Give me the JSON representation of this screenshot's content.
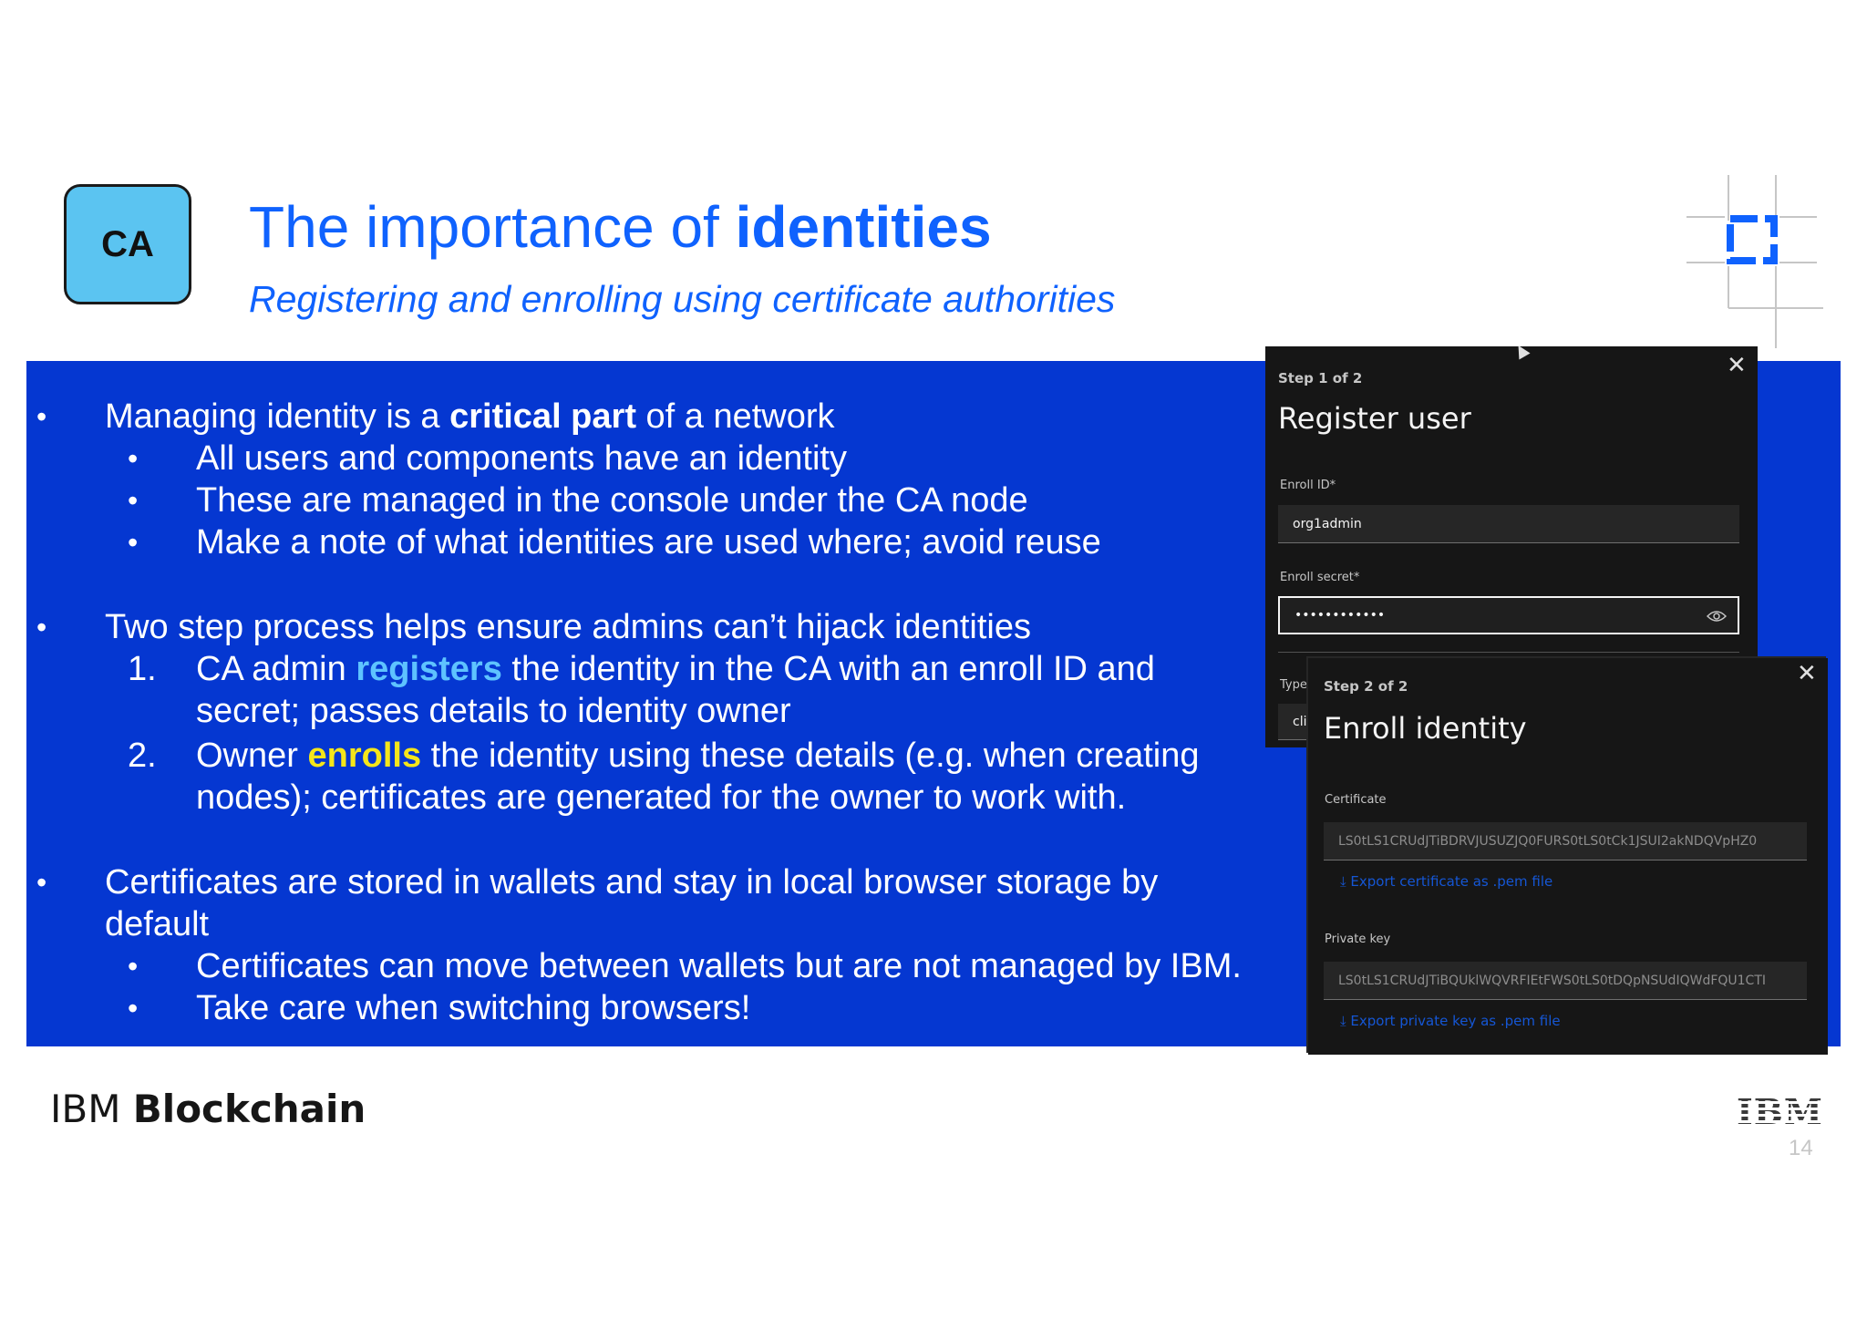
{
  "slide": {
    "badge": "CA",
    "title_plain": "The importance of ",
    "title_bold": "identities",
    "subtitle": "Registering and enrolling using certificate authorities",
    "bullet_char": "•",
    "b1": {
      "pre": "Managing identity is a ",
      "bold": "critical part",
      "post": " of a network"
    },
    "b1_subs": [
      "All users and components have an identity",
      "These are managed in the console under the CA node",
      "Make a note of what identities are used where; avoid reuse"
    ],
    "b2": "Two step process helps ensure admins can’t hijack identities",
    "n1": {
      "num": "1.",
      "pre": "CA admin ",
      "hl": "registers",
      "post": " the identity in the CA with an enroll ID and",
      "cont": "secret; passes details to identity owner"
    },
    "n2": {
      "num": "2.",
      "pre": "Owner ",
      "hl": "enrolls",
      "post": " the identity using these details (e.g. when creating",
      "cont": "nodes); certificates are generated for the owner to work with."
    },
    "b3": {
      "line1": "Certificates are stored in wallets and stay in local browser storage by",
      "line2": "default"
    },
    "b3_subs": [
      "Certificates can move between wallets but are not managed by IBM.",
      "Take care when switching browsers!"
    ]
  },
  "register_dialog": {
    "step": "Step 1 of 2",
    "title": "Register user",
    "enroll_id_label": "Enroll ID*",
    "enroll_id_value": "org1admin",
    "enroll_secret_label": "Enroll secret*",
    "enroll_secret_value": "••••••••••••",
    "type_label": "Type",
    "type_value": "cli"
  },
  "enroll_dialog": {
    "step": "Step 2 of 2",
    "title": "Enroll identity",
    "certificate_label": "Certificate",
    "certificate_value": "LS0tLS1CRUdJTiBDRVJUSUZJQ0FURS0tLS0tCk1JSUI2akNDQVpHZ0",
    "export_cert": "Export certificate as .pem file",
    "private_key_label": "Private key",
    "private_key_value": "LS0tLS1CRUdJTiBQUklWQVRFIEtFWS0tLS0tDQpNSUdIQWdFQU1CTI",
    "export_key": "Export private key as .pem file"
  },
  "footer": {
    "brand_plain": "IBM ",
    "brand_bold": "Blockchain",
    "logo": "IBM",
    "page_number": "14"
  },
  "colors": {
    "ibm_blue": "#0f62fe",
    "panel_blue": "#0537d1",
    "highlight_blue": "#5ec3ff",
    "highlight_yellow": "#f5e61a",
    "badge_fill": "#5bc4f1"
  }
}
